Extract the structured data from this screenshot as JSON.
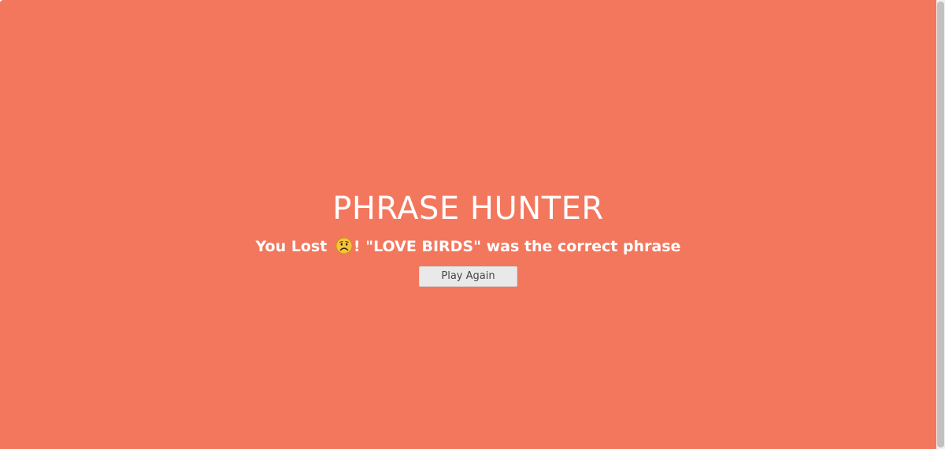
{
  "game": {
    "title": "PHRASE HUNTER",
    "message_prefix": "You Lost ",
    "message_emoji": "sad-face-icon",
    "message_suffix": "! \"LOVE BIRDS\" was the correct phrase",
    "play_again_label": "Play Again"
  },
  "colors": {
    "background": "#f3775d",
    "text": "#ffffff",
    "button_bg": "#e9e9e9",
    "button_text": "#444444"
  }
}
